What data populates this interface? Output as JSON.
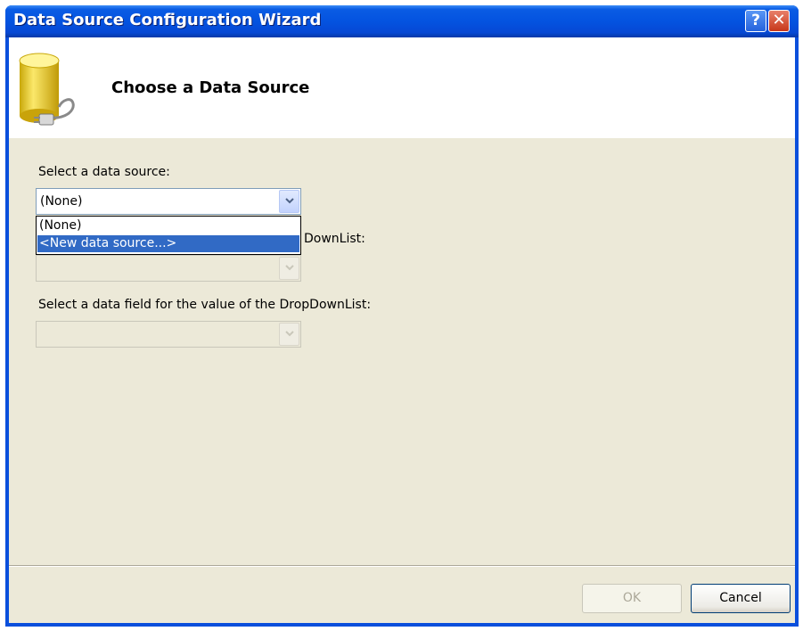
{
  "window": {
    "title": "Data Source Configuration Wizard"
  },
  "titlebar_buttons": {
    "help": "?",
    "close": "✕"
  },
  "header": {
    "title": "Choose a Data Source",
    "icon": "database-plug-icon"
  },
  "fields": {
    "data_source": {
      "label": "Select a data source:",
      "value": "(None)"
    },
    "display_field": {
      "label_visible": "DownList:",
      "value": ""
    },
    "value_field": {
      "label": "Select a data field for the value of the DropDownList:",
      "value": ""
    }
  },
  "dropdown": {
    "options": [
      "(None)",
      "<New data source...>"
    ],
    "selected_index": 1
  },
  "buttons": {
    "ok": "OK",
    "cancel": "Cancel"
  },
  "colors": {
    "titlebar": "#0453e0",
    "selection": "#316ac5",
    "dialog_bg": "#ece9d8"
  }
}
